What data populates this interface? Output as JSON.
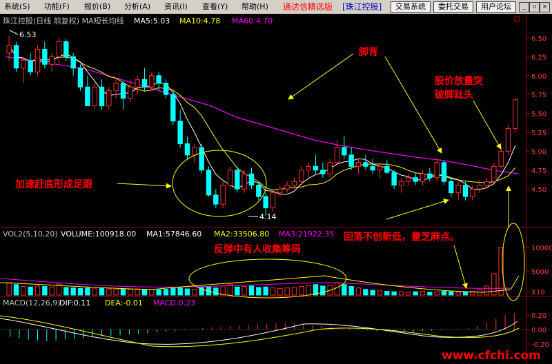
{
  "menubar": {
    "items": [
      "系统(S)",
      "功能(F)",
      "报价(B)",
      "分析(A)",
      "资讯(I)",
      "查看(Y)",
      "帮助(H)"
    ],
    "brand": "通达信精选版",
    "stock_name": "[珠江控股]",
    "buttons": [
      "交易系统",
      "委托交易",
      "用户论坛"
    ],
    "window_controls": [
      "_",
      "▫",
      "×"
    ]
  },
  "main_panel": {
    "title": "珠江控股(日线 前复权) MA短长均线",
    "ma5_label": "MA5:5.03",
    "ma10_label": "MA10:4.78",
    "ma60_label": "MA60:4.70",
    "high_marker": "6.53",
    "low_marker": "4.14",
    "y_ticks": [
      "6.50",
      "6.25",
      "6.00",
      "5.75",
      "5.50",
      "5.25",
      "5.00",
      "4.75",
      "4.50"
    ]
  },
  "volume_panel": {
    "title": "VOL2(5,10,20)",
    "volume_label": "VOLUME:100918.00",
    "ma1_label": "MA1:57846.60",
    "ma2_label": "MA2:33506.80",
    "ma3_label": "MA3:21922.35",
    "y_ticks": [
      "10000",
      "5000",
      "X10"
    ]
  },
  "macd_panel": {
    "title": "MACD(12,26,9)",
    "dif_label": "DIF:0.11",
    "dea_label": "DEA:-0.01",
    "macd_label": "MACD:0.23",
    "y_ticks": [
      "0.20",
      "0.00",
      "-0.20"
    ]
  },
  "annotations": {
    "jiaobei": "脚背",
    "breakout": [
      "股价放量突",
      "破脚趾头"
    ],
    "accelerate": "加速赶底形成足跟",
    "rebound": "反弹中有人收集筹码",
    "pullback": "回落不创新低，量芝麻点。"
  },
  "watermark": "www.cfchi.com",
  "colors": {
    "up": "#ff3030",
    "down": "#00ffff",
    "ma5": "#ffffff",
    "ma10": "#ffff00",
    "ma60": "#ff00ff",
    "annotation": "#ff0000",
    "arrow": "#ffff00",
    "ellipse": "#ffff00"
  },
  "chart_data": {
    "type": "candlestick",
    "price_ylim": [
      4.1,
      6.6
    ],
    "candles": [
      {
        "o": 6.3,
        "h": 6.53,
        "l": 6.2,
        "c": 6.4
      },
      {
        "o": 6.4,
        "h": 6.45,
        "l": 6.05,
        "c": 6.1
      },
      {
        "o": 6.1,
        "h": 6.25,
        "l": 5.9,
        "c": 6.2
      },
      {
        "o": 6.2,
        "h": 6.3,
        "l": 6.0,
        "c": 6.05
      },
      {
        "o": 6.05,
        "h": 6.4,
        "l": 6.0,
        "c": 6.35
      },
      {
        "o": 6.35,
        "h": 6.45,
        "l": 6.1,
        "c": 6.15
      },
      {
        "o": 6.15,
        "h": 6.3,
        "l": 6.05,
        "c": 6.25
      },
      {
        "o": 6.25,
        "h": 6.5,
        "l": 6.15,
        "c": 6.45
      },
      {
        "o": 6.45,
        "h": 6.48,
        "l": 6.2,
        "c": 6.25
      },
      {
        "o": 6.25,
        "h": 6.3,
        "l": 6.0,
        "c": 6.1
      },
      {
        "o": 6.1,
        "h": 6.15,
        "l": 5.8,
        "c": 5.85
      },
      {
        "o": 5.85,
        "h": 6.0,
        "l": 5.6,
        "c": 5.6
      },
      {
        "o": 5.6,
        "h": 5.9,
        "l": 5.55,
        "c": 5.85
      },
      {
        "o": 5.85,
        "h": 5.95,
        "l": 5.55,
        "c": 5.6
      },
      {
        "o": 5.6,
        "h": 5.85,
        "l": 5.55,
        "c": 5.8
      },
      {
        "o": 5.8,
        "h": 5.95,
        "l": 5.7,
        "c": 5.9
      },
      {
        "o": 5.9,
        "h": 5.92,
        "l": 5.55,
        "c": 5.7
      },
      {
        "o": 5.7,
        "h": 5.95,
        "l": 5.65,
        "c": 5.85
      },
      {
        "o": 5.85,
        "h": 6.0,
        "l": 5.75,
        "c": 5.95
      },
      {
        "o": 5.95,
        "h": 6.1,
        "l": 5.8,
        "c": 5.85
      },
      {
        "o": 5.85,
        "h": 6.05,
        "l": 5.8,
        "c": 6.0
      },
      {
        "o": 6.0,
        "h": 6.05,
        "l": 5.8,
        "c": 5.9
      },
      {
        "o": 5.9,
        "h": 5.95,
        "l": 5.7,
        "c": 5.75
      },
      {
        "o": 5.75,
        "h": 5.8,
        "l": 5.35,
        "c": 5.4
      },
      {
        "o": 5.4,
        "h": 5.55,
        "l": 5.05,
        "c": 5.1
      },
      {
        "o": 5.1,
        "h": 5.2,
        "l": 4.9,
        "c": 4.95
      },
      {
        "o": 4.95,
        "h": 5.1,
        "l": 4.85,
        "c": 5.05
      },
      {
        "o": 5.05,
        "h": 5.1,
        "l": 4.7,
        "c": 4.75
      },
      {
        "o": 4.75,
        "h": 4.8,
        "l": 4.4,
        "c": 4.42
      },
      {
        "o": 4.42,
        "h": 4.5,
        "l": 4.25,
        "c": 4.3
      },
      {
        "o": 4.3,
        "h": 4.6,
        "l": 4.25,
        "c": 4.55
      },
      {
        "o": 4.55,
        "h": 4.8,
        "l": 4.5,
        "c": 4.75
      },
      {
        "o": 4.75,
        "h": 4.8,
        "l": 4.45,
        "c": 4.5
      },
      {
        "o": 4.5,
        "h": 4.75,
        "l": 4.45,
        "c": 4.7
      },
      {
        "o": 4.7,
        "h": 4.78,
        "l": 4.5,
        "c": 4.55
      },
      {
        "o": 4.55,
        "h": 4.6,
        "l": 4.35,
        "c": 4.4
      },
      {
        "o": 4.4,
        "h": 4.45,
        "l": 4.14,
        "c": 4.25
      },
      {
        "o": 4.25,
        "h": 4.5,
        "l": 4.2,
        "c": 4.45
      },
      {
        "o": 4.45,
        "h": 4.55,
        "l": 4.4,
        "c": 4.5
      },
      {
        "o": 4.5,
        "h": 4.6,
        "l": 4.45,
        "c": 4.55
      },
      {
        "o": 4.55,
        "h": 4.65,
        "l": 4.5,
        "c": 4.6
      },
      {
        "o": 4.6,
        "h": 4.8,
        "l": 4.55,
        "c": 4.75
      },
      {
        "o": 4.75,
        "h": 4.85,
        "l": 4.65,
        "c": 4.8
      },
      {
        "o": 4.8,
        "h": 4.95,
        "l": 4.7,
        "c": 4.75
      },
      {
        "o": 4.75,
        "h": 4.85,
        "l": 4.65,
        "c": 4.7
      },
      {
        "o": 4.7,
        "h": 4.9,
        "l": 4.65,
        "c": 4.85
      },
      {
        "o": 4.85,
        "h": 5.15,
        "l": 4.8,
        "c": 5.05
      },
      {
        "o": 5.05,
        "h": 5.2,
        "l": 4.9,
        "c": 4.95
      },
      {
        "o": 4.95,
        "h": 5.05,
        "l": 4.75,
        "c": 4.8
      },
      {
        "o": 4.8,
        "h": 4.9,
        "l": 4.7,
        "c": 4.85
      },
      {
        "o": 4.85,
        "h": 4.95,
        "l": 4.75,
        "c": 4.8
      },
      {
        "o": 4.8,
        "h": 4.9,
        "l": 4.7,
        "c": 4.75
      },
      {
        "o": 4.75,
        "h": 4.85,
        "l": 4.65,
        "c": 4.8
      },
      {
        "o": 4.8,
        "h": 4.88,
        "l": 4.7,
        "c": 4.72
      },
      {
        "o": 4.72,
        "h": 4.75,
        "l": 4.5,
        "c": 4.55
      },
      {
        "o": 4.55,
        "h": 4.65,
        "l": 4.45,
        "c": 4.6
      },
      {
        "o": 4.6,
        "h": 4.7,
        "l": 4.55,
        "c": 4.65
      },
      {
        "o": 4.65,
        "h": 4.72,
        "l": 4.55,
        "c": 4.6
      },
      {
        "o": 4.6,
        "h": 4.75,
        "l": 4.55,
        "c": 4.7
      },
      {
        "o": 4.7,
        "h": 4.78,
        "l": 4.6,
        "c": 4.65
      },
      {
        "o": 4.65,
        "h": 4.9,
        "l": 4.6,
        "c": 4.85
      },
      {
        "o": 4.85,
        "h": 4.88,
        "l": 4.55,
        "c": 4.6
      },
      {
        "o": 4.6,
        "h": 4.65,
        "l": 4.4,
        "c": 4.45
      },
      {
        "o": 4.45,
        "h": 4.6,
        "l": 4.35,
        "c": 4.55
      },
      {
        "o": 4.55,
        "h": 4.6,
        "l": 4.35,
        "c": 4.4
      },
      {
        "o": 4.4,
        "h": 4.55,
        "l": 4.35,
        "c": 4.5
      },
      {
        "o": 4.5,
        "h": 4.62,
        "l": 4.45,
        "c": 4.55
      },
      {
        "o": 4.55,
        "h": 4.65,
        "l": 4.5,
        "c": 4.6
      },
      {
        "o": 4.6,
        "h": 4.85,
        "l": 4.58,
        "c": 4.8
      },
      {
        "o": 4.8,
        "h": 5.05,
        "l": 4.78,
        "c": 5.0
      },
      {
        "o": 5.0,
        "h": 5.35,
        "l": 4.95,
        "c": 5.3
      },
      {
        "o": 5.3,
        "h": 5.7,
        "l": 5.25,
        "c": 5.68
      }
    ],
    "ma60_y": [
      6.25,
      6.2,
      6.15,
      6.1,
      6.0,
      5.9,
      5.8,
      5.7,
      5.6,
      5.45,
      5.35,
      5.25,
      5.15,
      5.08,
      5.02,
      4.97,
      4.92,
      4.88,
      4.82,
      4.75,
      4.7
    ],
    "volume": [
      2600,
      2200,
      1800,
      1700,
      1900,
      1800,
      1700,
      2300,
      1600,
      1500,
      1400,
      1500,
      1300,
      1400,
      1300,
      1200,
      1300,
      1200,
      1300,
      1200,
      1200,
      1100,
      1200,
      1400,
      1500,
      1300,
      1200,
      1600,
      1700,
      1500,
      1900,
      2300,
      1700,
      1800,
      1900,
      1600,
      1700,
      1500,
      1400,
      1500,
      1600,
      1800,
      2000,
      2200,
      1900,
      2000,
      2600,
      2200,
      1800,
      1500,
      1200,
      1000,
      900,
      800,
      700,
      700,
      600,
      700,
      800,
      600,
      700,
      800,
      700,
      600,
      700,
      800,
      1100,
      1900,
      4500,
      10000
    ],
    "macd_hist": [
      -0.1,
      -0.12,
      -0.14,
      -0.15,
      -0.16,
      -0.15,
      -0.14,
      -0.13,
      -0.12,
      -0.11,
      -0.1,
      -0.09,
      -0.08,
      -0.07,
      -0.06,
      -0.05,
      -0.04,
      -0.03,
      -0.02,
      -0.01,
      0.01,
      0.02,
      0.03,
      0.04,
      0.05,
      0.06,
      0.07,
      0.08,
      0.08,
      0.09,
      0.09,
      0.08,
      0.07,
      0.06,
      0.05,
      0.04,
      0.03,
      0.02,
      0.01,
      -0.01,
      -0.02,
      -0.03,
      -0.03,
      -0.04,
      -0.03,
      -0.02,
      -0.02,
      -0.01,
      0.0,
      0.01,
      0.02,
      0.05,
      0.1,
      0.15,
      0.2,
      0.23
    ]
  }
}
